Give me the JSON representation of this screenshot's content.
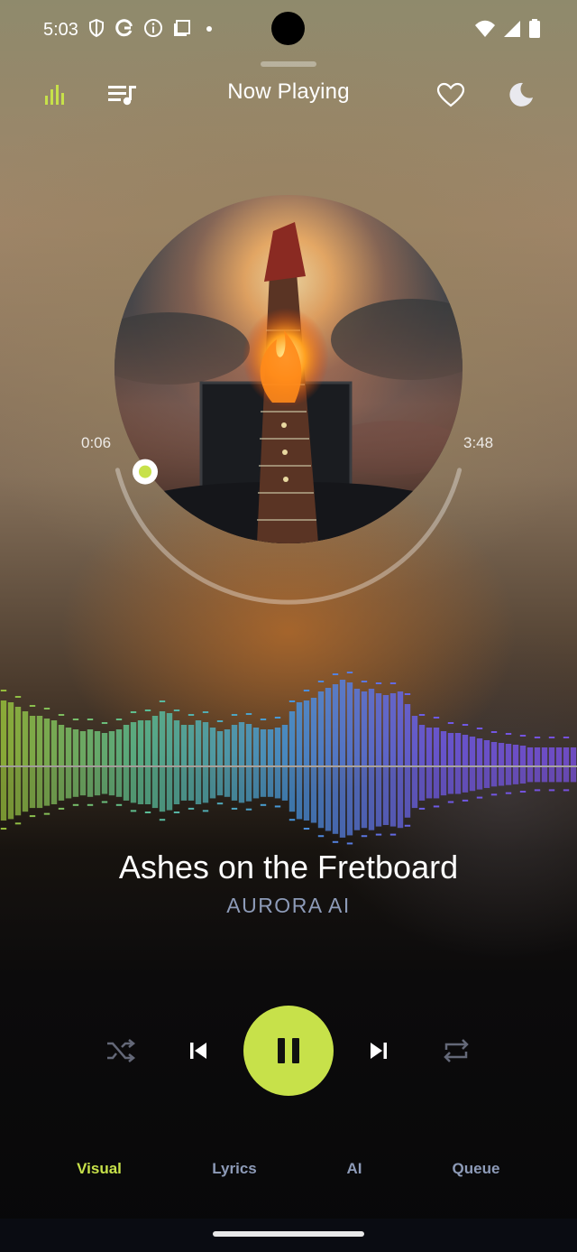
{
  "status_bar": {
    "time": "5:03",
    "left_icons": [
      "shield-icon",
      "google-icon",
      "info-icon",
      "screenshot-icon",
      "dot-icon"
    ],
    "right_icons": [
      "wifi-icon",
      "signal-icon",
      "battery-icon"
    ]
  },
  "header": {
    "title": "Now Playing",
    "left_icons": [
      "equalizer-icon",
      "playlist-icon"
    ],
    "right_icons": [
      "heart-icon",
      "moon-icon"
    ]
  },
  "player": {
    "elapsed": "0:06",
    "duration": "3:48",
    "progress_fraction": 0.026,
    "song_title": "Ashes on the Fretboard",
    "artist": "AURORA AI"
  },
  "controls": [
    "shuffle-icon",
    "previous-icon",
    "pause-icon",
    "next-icon",
    "repeat-icon"
  ],
  "tabs": [
    {
      "label": "Visual",
      "active": true
    },
    {
      "label": "Lyrics",
      "active": false
    },
    {
      "label": "AI",
      "active": false
    },
    {
      "label": "Queue",
      "active": false
    }
  ],
  "colors": {
    "accent": "#c7e14a",
    "inactive_tab": "#8d9bb8",
    "artist": "#8d9bb8"
  },
  "visualizer_levels": [
    0.72,
    0.7,
    0.65,
    0.6,
    0.55,
    0.55,
    0.52,
    0.5,
    0.45,
    0.42,
    0.4,
    0.38,
    0.4,
    0.38,
    0.36,
    0.38,
    0.4,
    0.45,
    0.48,
    0.5,
    0.5,
    0.55,
    0.6,
    0.58,
    0.5,
    0.45,
    0.45,
    0.5,
    0.48,
    0.42,
    0.38,
    0.4,
    0.45,
    0.48,
    0.46,
    0.42,
    0.4,
    0.4,
    0.42,
    0.45,
    0.6,
    0.7,
    0.72,
    0.75,
    0.82,
    0.86,
    0.9,
    0.95,
    0.92,
    0.85,
    0.82,
    0.85,
    0.8,
    0.78,
    0.8,
    0.82,
    0.68,
    0.55,
    0.45,
    0.42,
    0.42,
    0.38,
    0.36,
    0.36,
    0.34,
    0.32,
    0.3,
    0.28,
    0.26,
    0.25,
    0.24,
    0.23,
    0.22,
    0.2,
    0.2,
    0.2,
    0.2,
    0.2,
    0.2,
    0.2
  ]
}
